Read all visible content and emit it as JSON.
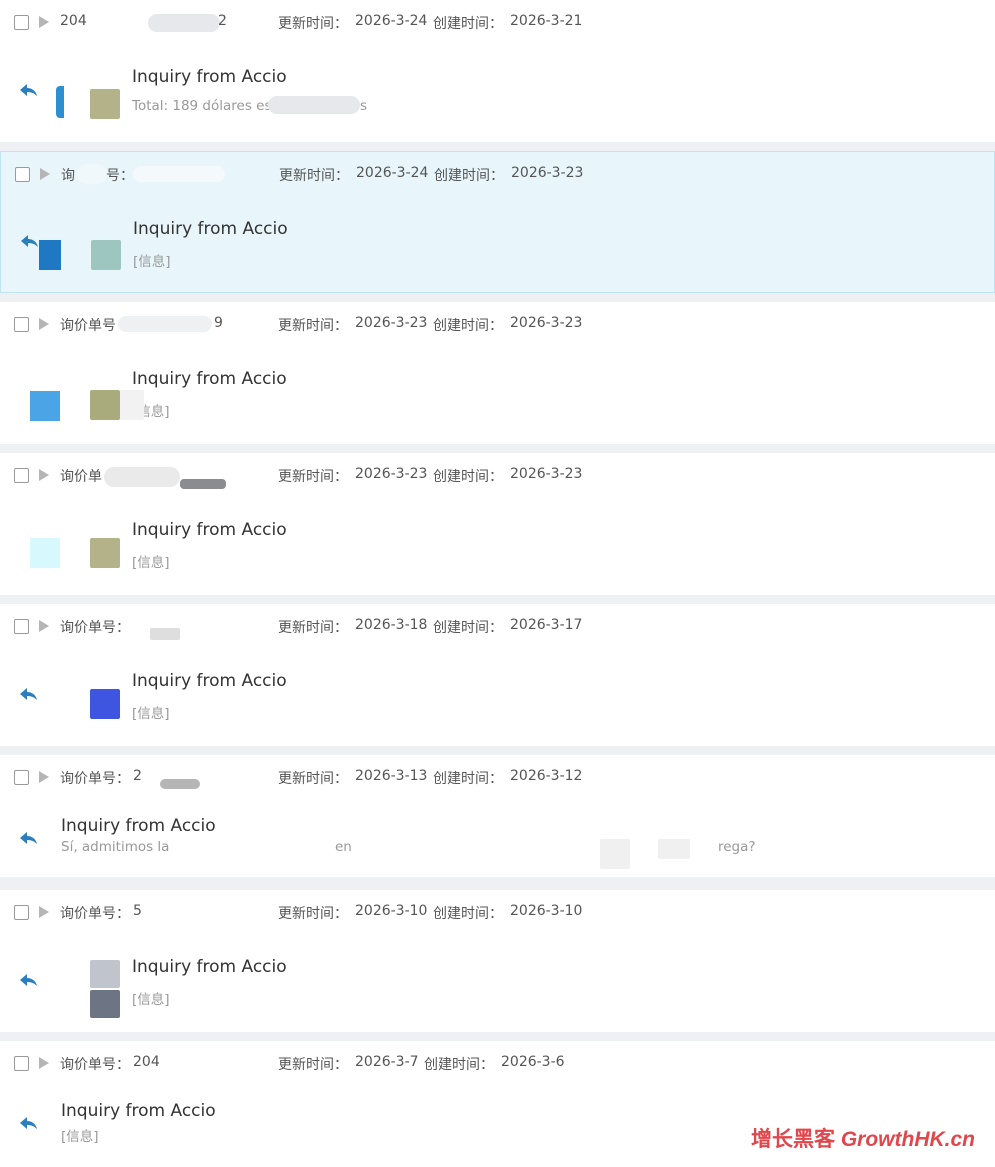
{
  "labels": {
    "inquiry_no": "询价单号：",
    "update_time": "更新时间：",
    "create_time": "创建时间："
  },
  "inquiries": [
    {
      "inquiry_no": "204",
      "inquiry_no_tail": "2",
      "updated": "2026-3-24",
      "created": "2026-3-21",
      "title": "Inquiry from Accio",
      "preview": "Total: 189 dólares es",
      "preview_tail": "s"
    },
    {
      "inquiry_no": "询",
      "inquiry_no_tail": "号：",
      "updated": "2026-3-24",
      "created": "2026-3-23",
      "title": "Inquiry from Accio",
      "preview": "[信息]"
    },
    {
      "inquiry_no": "询价单号",
      "inquiry_no_tail": "9",
      "updated": "2026-3-23",
      "created": "2026-3-23",
      "title": "Inquiry from Accio",
      "preview": "[信息]"
    },
    {
      "inquiry_no": "询价单",
      "updated": "2026-3-23",
      "created": "2026-3-23",
      "title": "Inquiry from Accio",
      "preview": "[信息]"
    },
    {
      "inquiry_no": "询价单号：",
      "updated": "2026-3-18",
      "created": "2026-3-17",
      "title": "Inquiry from Accio",
      "preview": "[信息]"
    },
    {
      "inquiry_no": "询价单号：",
      "inquiry_no_tail": "2",
      "updated": "2026-3-13",
      "created": "2026-3-12",
      "title": "Inquiry from Accio",
      "preview": "Sí, admitimos la",
      "preview_mid": "en",
      "preview_tail": "rega?"
    },
    {
      "inquiry_no": "询价单号：",
      "inquiry_no_tail": "5",
      "updated": "2026-3-10",
      "created": "2026-3-10",
      "title": "Inquiry from Accio",
      "preview": "[信息]"
    },
    {
      "inquiry_no": "询价单号：",
      "inquiry_no_tail": "204",
      "updated": "2026-3-7",
      "created": "2026-3-6",
      "title": "Inquiry from Accio",
      "preview": "[信息]"
    }
  ],
  "icons": {
    "reply": "reply-arrow-icon",
    "expand": "expand-triangle-icon",
    "checkbox": "checkbox"
  },
  "colors": {
    "reply_icon": "#2b7fbf",
    "selected_bg": "#e8f6fb",
    "watermark": "#e0474c"
  },
  "watermark": {
    "cn": "增长黑客",
    "en": "GrowthHK.cn"
  }
}
